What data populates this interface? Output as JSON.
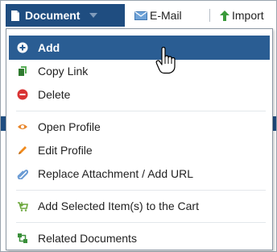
{
  "toolbar": {
    "document_label": "Document",
    "email_label": "E-Mail",
    "import_label": "Import"
  },
  "menu": {
    "items": [
      {
        "label": "Add",
        "icon": "plus-circle-icon",
        "color": "#ffffff",
        "highlighted": true
      },
      {
        "label": "Copy Link",
        "icon": "copy-link-icon",
        "color": "#3a8f3a"
      },
      {
        "label": "Delete",
        "icon": "delete-icon",
        "color": "#d93434"
      },
      {
        "label": "Open Profile",
        "icon": "eye-icon",
        "color": "#e07b1a"
      },
      {
        "label": "Edit Profile",
        "icon": "pencil-icon",
        "color": "#e07b1a"
      },
      {
        "label": "Replace Attachment / Add URL",
        "icon": "paperclip-icon",
        "color": "#6a9bd4"
      },
      {
        "label": "Add Selected Item(s) to the Cart",
        "icon": "cart-icon",
        "color": "#6aa63a"
      },
      {
        "label": "Related Documents",
        "icon": "related-docs-icon",
        "color": "#3a8f3a"
      }
    ]
  },
  "colors": {
    "toolbar_button": "#1f4d80",
    "menu_highlight": "#2a5d93"
  }
}
